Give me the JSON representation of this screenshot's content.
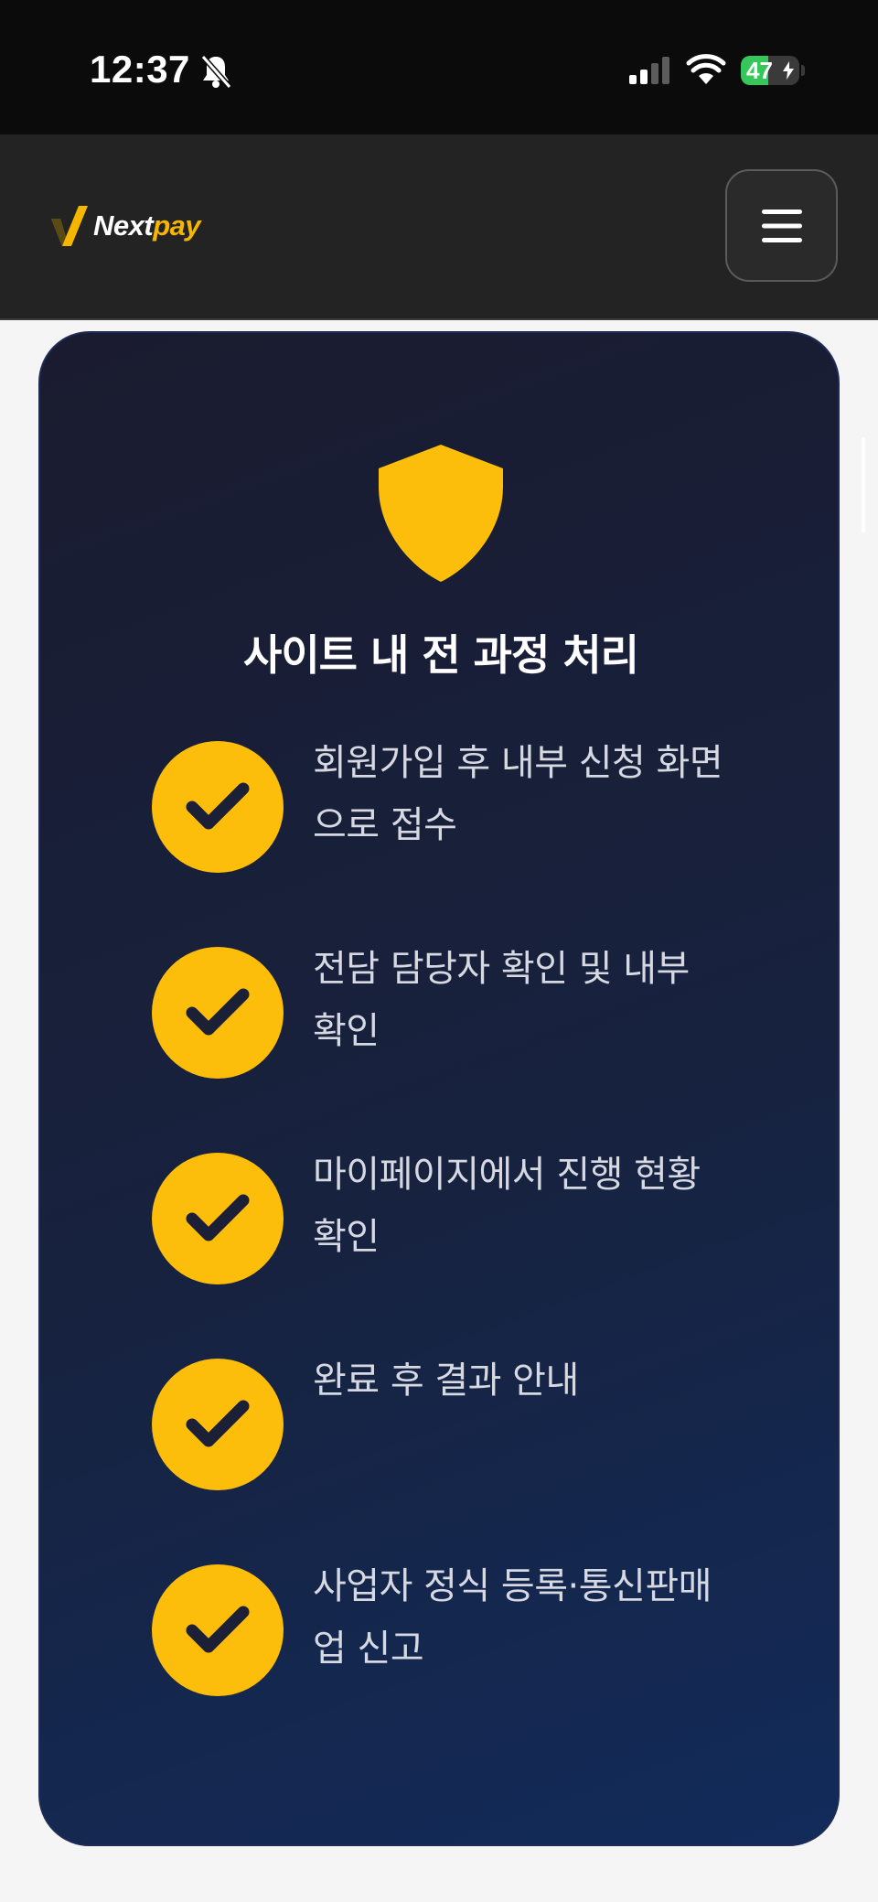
{
  "status_bar": {
    "time": "12:37",
    "battery_percent": 47,
    "battery_label": "47",
    "icons": [
      "bell-slash-icon",
      "cellular-signal-icon",
      "wifi-icon",
      "battery-charging-icon"
    ]
  },
  "header": {
    "logo_next": "Nextpay",
    "logo_next_part": "Next",
    "logo_pay_part": "pay",
    "menu_icon": "hamburger-menu-icon"
  },
  "card": {
    "icon": "shield-icon",
    "title": "사이트 내 전 과정 처리",
    "items": [
      {
        "text": "회원가입 후 내부 신청 화면으로 접수",
        "icon": "check-icon"
      },
      {
        "text": "전담 담당자 확인 및 내부 확인",
        "icon": "check-icon"
      },
      {
        "text": "마이페이지에서 진행 현황 확인",
        "icon": "check-icon"
      },
      {
        "text": "완료 후 결과 안내",
        "icon": "check-icon"
      },
      {
        "text": "사업자 정식 등록·통신판매업 신고",
        "icon": "check-icon"
      }
    ]
  },
  "colors": {
    "accent": "#fdbd0b",
    "card_bg": "#17223f",
    "header_bg": "#232323",
    "status_bg": "#0b0b0b"
  }
}
